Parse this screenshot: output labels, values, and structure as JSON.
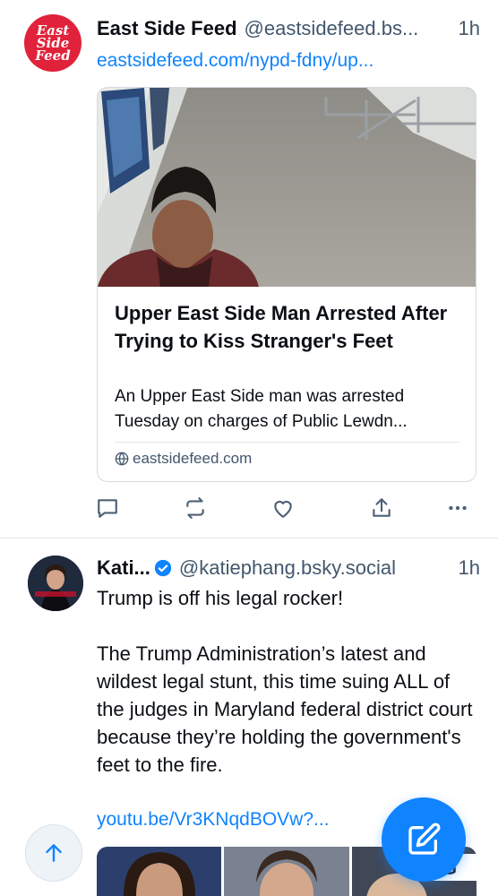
{
  "colors": {
    "accent": "#1083fe",
    "muted": "#42576c",
    "text": "#0b0f14",
    "brand_east_side": "#e0223a"
  },
  "posts": [
    {
      "avatar_text": [
        "East",
        "Side",
        "Feed"
      ],
      "display_name": "East Side Feed",
      "handle": "@eastsidefeed.bs...",
      "time": "1h",
      "link_text": "eastsidefeed.com/nypd-fdny/up...",
      "card": {
        "title": "Upper East Side Man Arrested After Trying to Kiss Stranger's Feet",
        "description": "An Upper East Side man was arrested Tuesday on charges of Public Lewdn...",
        "domain": "eastsidefeed.com"
      },
      "actions": [
        "reply-icon",
        "repost-icon",
        "like-icon",
        "share-icon",
        "more-icon"
      ]
    },
    {
      "display_name": "Kati...",
      "handle": "@katiephang.bsky.social",
      "time": "1h",
      "text_lines": [
        "Trump is off his legal rocker!",
        "",
        "The Trump Administration’s latest and wildest legal stunt, this time suing ALL of the judges in Maryland federal district court because they’re holding the government's feet to the fire."
      ],
      "link_text": "youtu.be/Vr3KNqdBOVw?...",
      "media_partial_text": "G"
    }
  ],
  "fab": {
    "scroll_top_icon": "arrow-up-icon",
    "compose_icon": "compose-icon"
  }
}
